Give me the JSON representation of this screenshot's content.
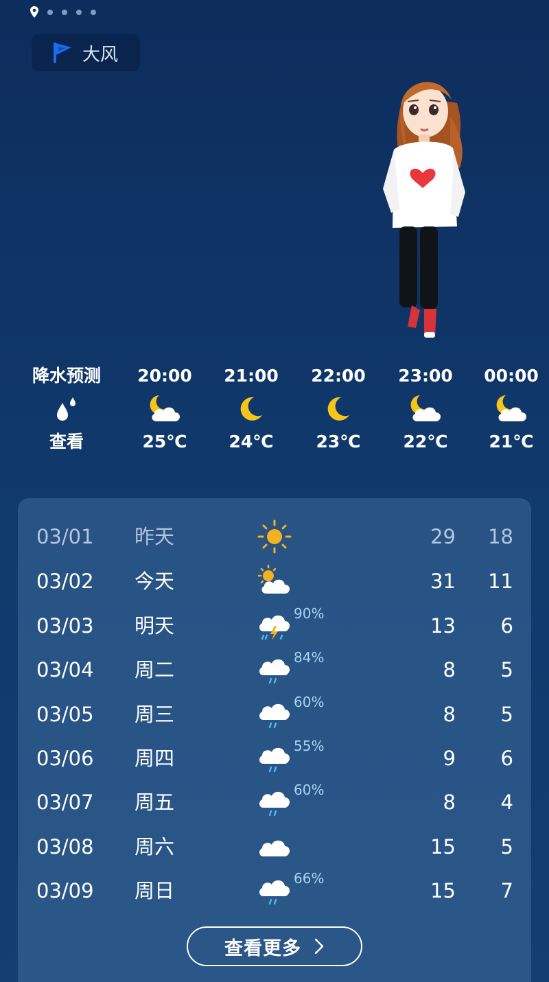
{
  "top": {
    "location_icon": "location-pin-icon",
    "page_indicator_count": 4
  },
  "alert": {
    "icon": "flag-icon",
    "label": "大风",
    "color": "#1d6cf0"
  },
  "hourly": {
    "precip_label": "降水预测",
    "precip_icon": "raindrops-icon",
    "view_label": "查看",
    "hours": [
      {
        "time": "20:00",
        "icon": "partly-cloudy-night-icon",
        "temp": "25℃"
      },
      {
        "time": "21:00",
        "icon": "crescent-moon-icon",
        "temp": "24℃"
      },
      {
        "time": "22:00",
        "icon": "crescent-moon-icon",
        "temp": "23℃"
      },
      {
        "time": "23:00",
        "icon": "partly-cloudy-night-icon",
        "temp": "22℃"
      },
      {
        "time": "00:00",
        "icon": "partly-cloudy-night-icon",
        "temp": "21℃"
      }
    ]
  },
  "forecast": {
    "days": [
      {
        "date": "03/01",
        "day": "昨天",
        "icon": "sun-icon",
        "prob": "",
        "high": "29",
        "low": "18"
      },
      {
        "date": "03/02",
        "day": "今天",
        "icon": "partly-cloudy-day-icon",
        "prob": "",
        "high": "31",
        "low": "11"
      },
      {
        "date": "03/03",
        "day": "明天",
        "icon": "thunderstorm-icon",
        "prob": "90%",
        "high": "13",
        "low": "6"
      },
      {
        "date": "03/04",
        "day": "周二",
        "icon": "rain-icon",
        "prob": "84%",
        "high": "8",
        "low": "5"
      },
      {
        "date": "03/05",
        "day": "周三",
        "icon": "rain-icon",
        "prob": "60%",
        "high": "8",
        "low": "5"
      },
      {
        "date": "03/06",
        "day": "周四",
        "icon": "rain-icon",
        "prob": "55%",
        "high": "9",
        "low": "6"
      },
      {
        "date": "03/07",
        "day": "周五",
        "icon": "rain-icon",
        "prob": "60%",
        "high": "8",
        "low": "4"
      },
      {
        "date": "03/08",
        "day": "周六",
        "icon": "cloud-icon",
        "prob": "",
        "high": "15",
        "low": "5"
      },
      {
        "date": "03/09",
        "day": "周日",
        "icon": "rain-icon",
        "prob": "66%",
        "high": "15",
        "low": "7"
      }
    ],
    "more_label": "查看更多",
    "more_icon": "chevron-right-icon"
  },
  "colors": {
    "background": "#10386b",
    "moon": "#f5c518",
    "sun": "#f3b21f",
    "rain_drop": "#4fb4f0",
    "probability": "#a7d6f6"
  }
}
